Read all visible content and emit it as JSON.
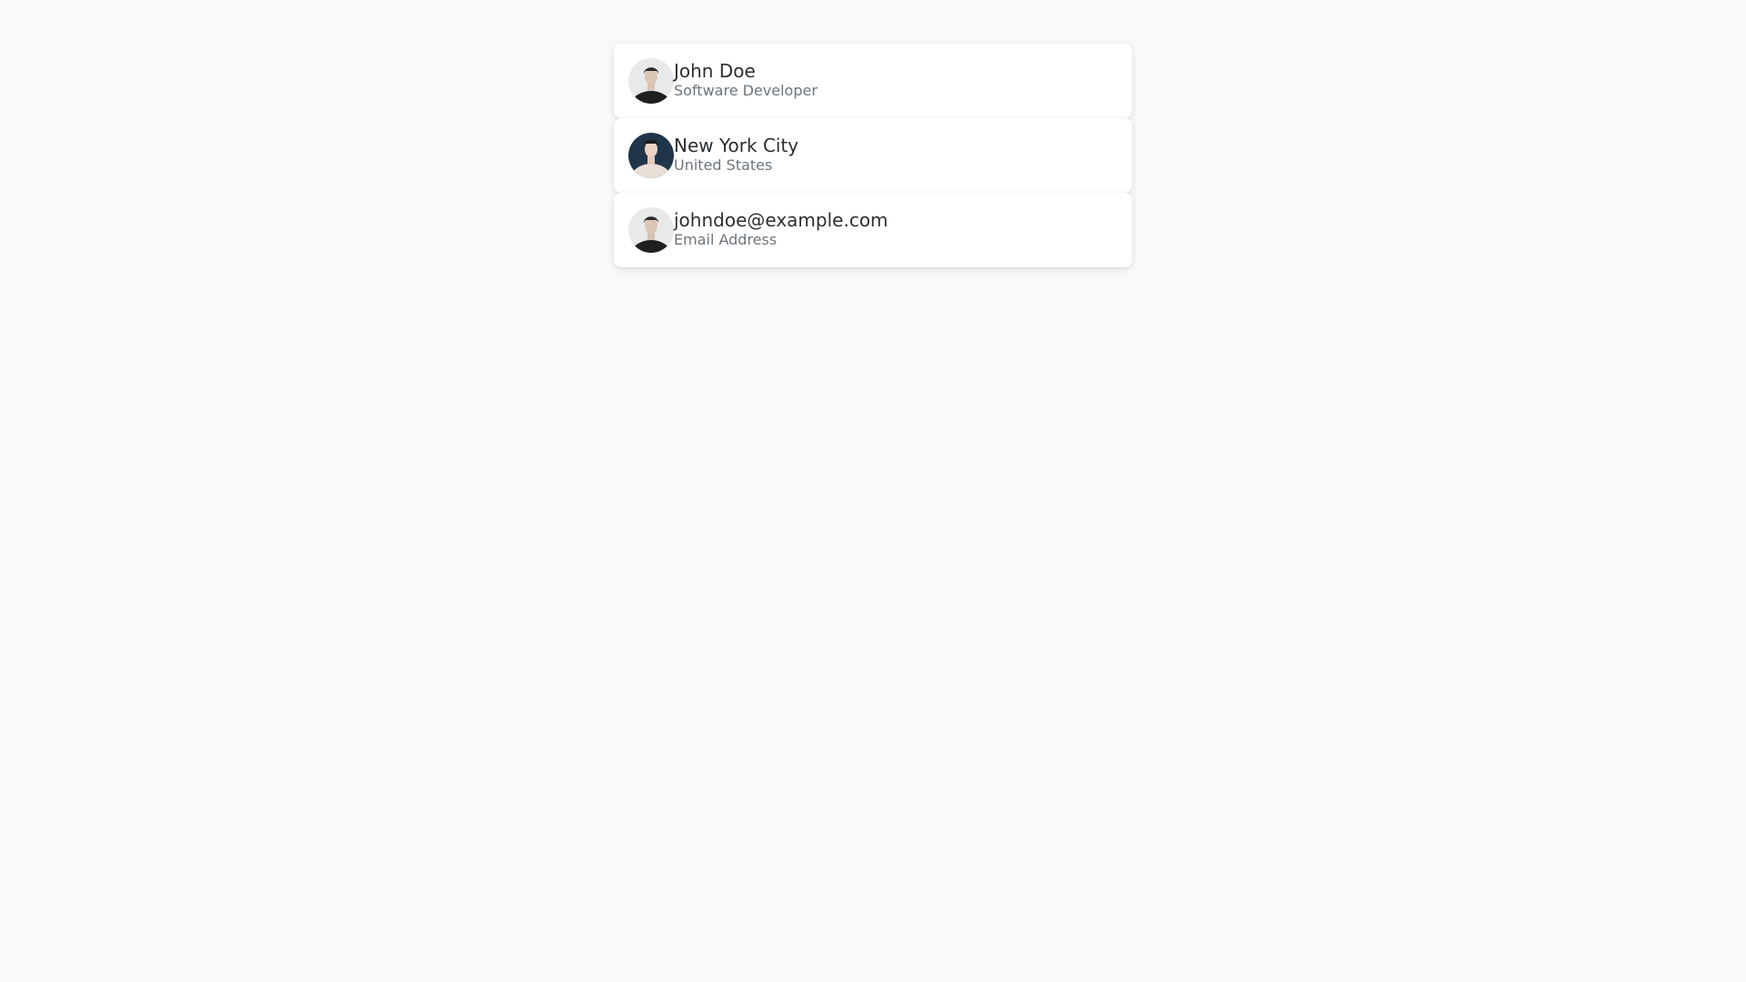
{
  "items": [
    {
      "title": "John Doe",
      "subtitle": "Software Developer",
      "avatar_icon": "person-avatar-icon"
    },
    {
      "title": "New York City",
      "subtitle": "United States",
      "avatar_icon": "person-avatar-icon"
    },
    {
      "title": "johndoe@example.com",
      "subtitle": "Email Address",
      "avatar_icon": "person-avatar-icon"
    }
  ],
  "colors": {
    "background": "#f8f9fa",
    "card": "#ffffff",
    "title": "#2b2f33",
    "subtitle": "#6c757d"
  }
}
